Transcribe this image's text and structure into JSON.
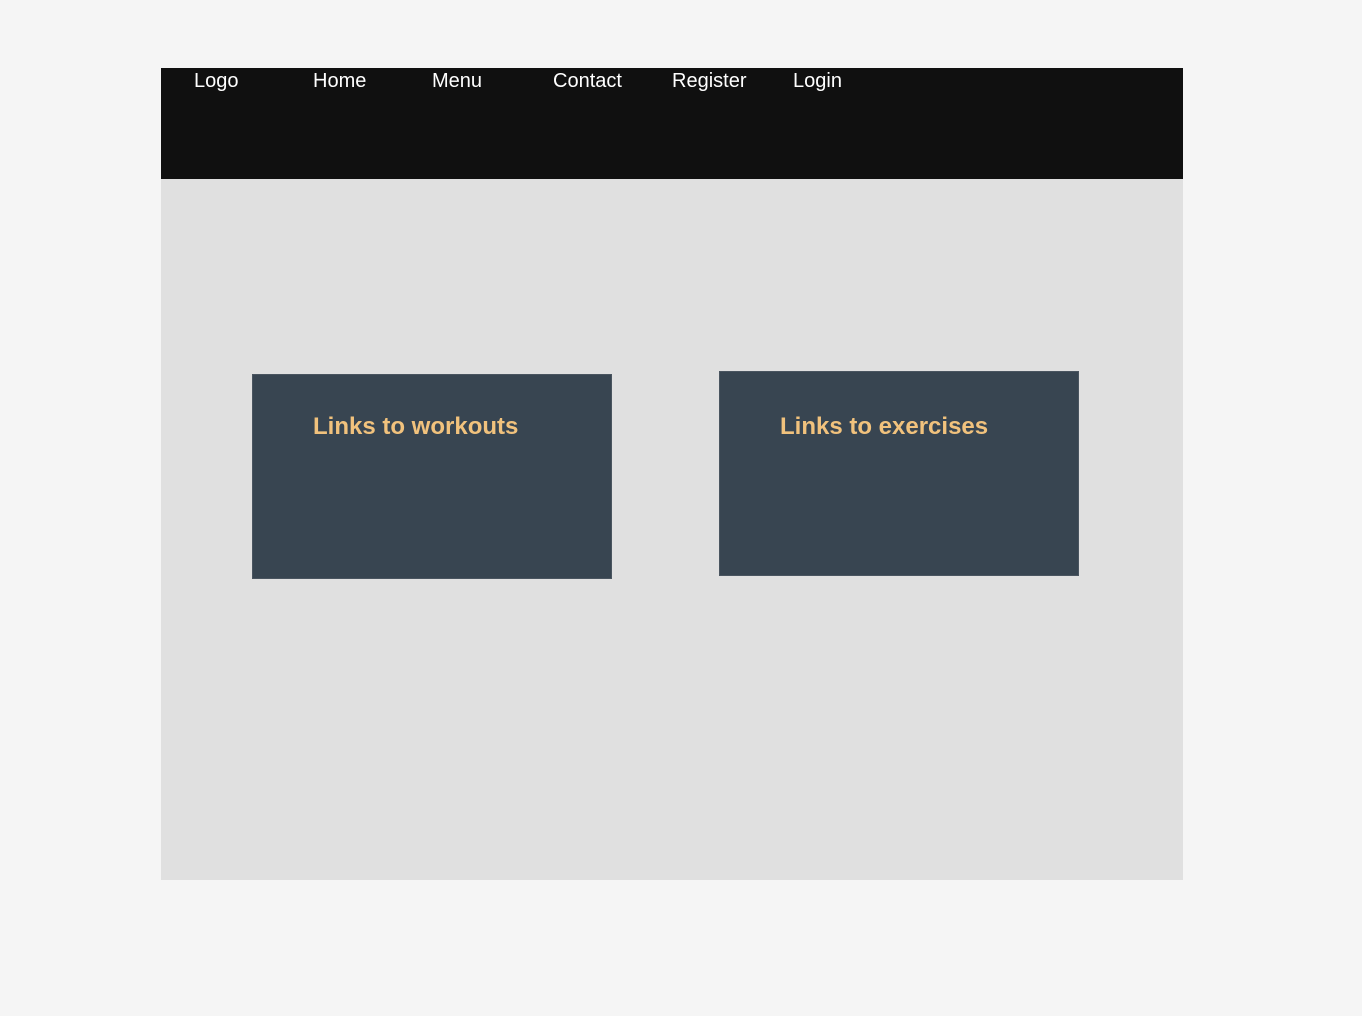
{
  "navbar": {
    "logo": "Logo",
    "items": [
      {
        "label": "Home"
      },
      {
        "label": "Menu"
      },
      {
        "label": "Contact"
      },
      {
        "label": "Register"
      },
      {
        "label": "Login"
      }
    ]
  },
  "cards": [
    {
      "title": "Links to workouts"
    },
    {
      "title": "Links to exercises"
    }
  ],
  "colors": {
    "page_background": "#f5f5f5",
    "content_background": "#e0e0e0",
    "navbar_background": "#101010",
    "card_background": "#384551",
    "card_title": "#f1c27d",
    "nav_text": "#ffffff"
  }
}
